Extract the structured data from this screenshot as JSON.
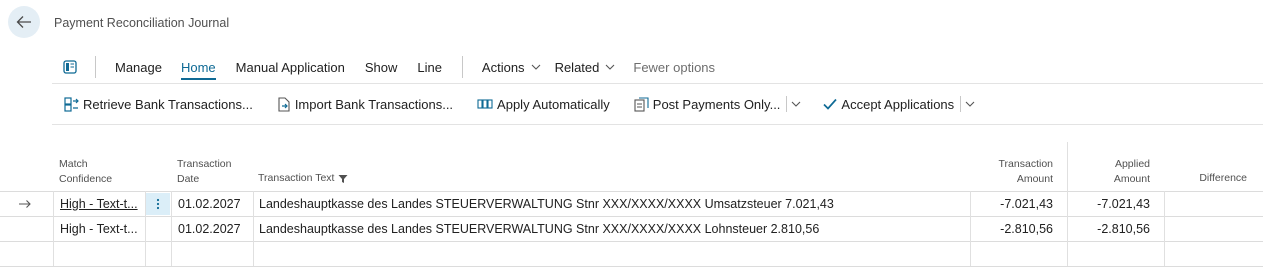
{
  "header": {
    "title": "Payment Reconciliation Journal"
  },
  "actionbar": {
    "manage": "Manage",
    "home": "Home",
    "manual_application": "Manual Application",
    "show": "Show",
    "line": "Line",
    "actions": "Actions",
    "related": "Related",
    "fewer_options": "Fewer options"
  },
  "ribbon": {
    "retrieve": "Retrieve Bank Transactions...",
    "import": "Import Bank Transactions...",
    "apply_auto": "Apply Automatically",
    "post_payments": "Post Payments Only...",
    "accept": "Accept Applications"
  },
  "table": {
    "headers": {
      "match_confidence_1": "Match",
      "match_confidence_2": "Confidence",
      "transaction_date_1": "Transaction",
      "transaction_date_2": "Date",
      "transaction_text": "Transaction Text",
      "transaction_amount_1": "Transaction",
      "transaction_amount_2": "Amount",
      "applied_amount_1": "Applied",
      "applied_amount_2": "Amount",
      "difference": "Difference"
    },
    "rows": [
      {
        "match_confidence": "High - Text-t...",
        "transaction_date": "01.02.2027",
        "transaction_text": "Landeshauptkasse des Landes STEUERVERWALTUNG Stnr XXX/XXXX/XXXX Umsatzsteuer 7.021,43",
        "transaction_amount": "-7.021,43",
        "applied_amount": "-7.021,43",
        "difference": ""
      },
      {
        "match_confidence": "High - Text-t...",
        "transaction_date": "01.02.2027",
        "transaction_text": "Landeshauptkasse des Landes STEUERVERWALTUNG Stnr XXX/XXXX/XXXX Lohnsteuer 2.810,56",
        "transaction_amount": "-2.810,56",
        "applied_amount": "-2.810,56",
        "difference": ""
      }
    ]
  },
  "colors": {
    "accent": "#0f6a95",
    "selected_cell": "#dbeef8",
    "back_button_bg": "#e4eef5"
  }
}
